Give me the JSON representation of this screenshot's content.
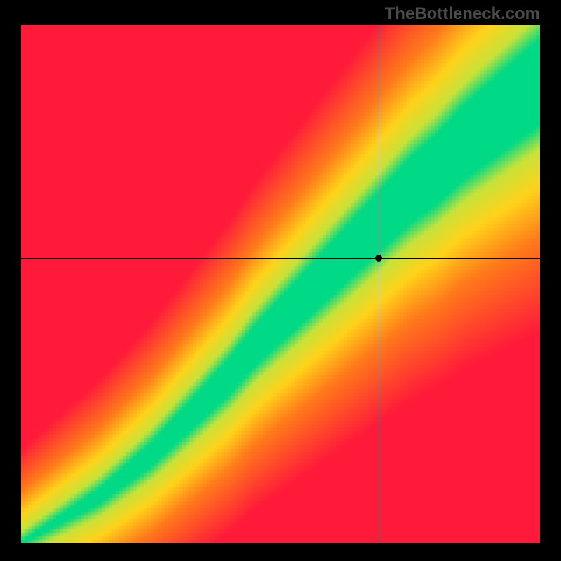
{
  "watermark": "TheBottleneck.com",
  "chart_data": {
    "type": "heatmap",
    "title": "",
    "xlabel": "",
    "ylabel": "",
    "xlim": [
      0,
      100
    ],
    "ylim": [
      0,
      100
    ],
    "crosshair": {
      "x": 69,
      "y": 55
    },
    "marker": {
      "x": 69,
      "y": 55
    },
    "optimal_band": {
      "comment": "Approximate y-center of the green optimal band as a function of x, plus half-width; values estimated from gradient shape.",
      "x": [
        0,
        5,
        10,
        15,
        20,
        25,
        30,
        35,
        40,
        45,
        50,
        55,
        60,
        65,
        70,
        75,
        80,
        85,
        90,
        95,
        100
      ],
      "center": [
        0,
        3,
        6,
        9,
        13,
        17,
        22,
        27,
        32,
        38,
        43,
        48,
        53,
        58,
        63,
        68,
        72,
        77,
        81,
        85,
        89
      ],
      "half_width": [
        0.2,
        0.6,
        1.0,
        1.4,
        1.8,
        2.2,
        2.6,
        3.0,
        3.4,
        3.8,
        4.2,
        4.6,
        5.0,
        5.4,
        5.8,
        6.2,
        6.6,
        7.0,
        7.4,
        7.8,
        8.2
      ]
    },
    "color_stops": {
      "comment": "Color mapping by normalized orthogonal distance from the optimal band (0 = on band, 1 = far). Hex colors.",
      "scale": [
        0.0,
        0.12,
        0.3,
        0.55,
        1.0
      ],
      "colors": [
        "#00d985",
        "#c8e23a",
        "#ffd21a",
        "#ff7a1a",
        "#ff1a3a"
      ]
    }
  }
}
